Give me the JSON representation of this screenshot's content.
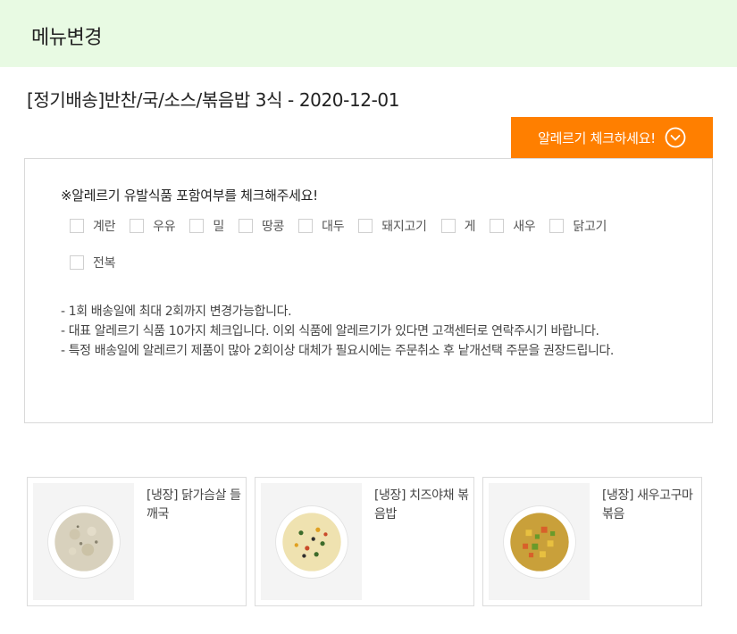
{
  "header": {
    "title": "메뉴변경"
  },
  "product": {
    "title": "[정기배송]반찬/국/소스/볶음밥 3식 - 2020-12-01"
  },
  "allergy_button": {
    "label": "알레르기 체크하세요!",
    "icon": "chevron-down-circle-icon",
    "color": "#ff7f00"
  },
  "allergy": {
    "title": "※알레르기 유발식품 포함여부를 체크해주세요!",
    "items": [
      {
        "label": "계란",
        "checked": false
      },
      {
        "label": "우유",
        "checked": false
      },
      {
        "label": "밀",
        "checked": false
      },
      {
        "label": "땅콩",
        "checked": false
      },
      {
        "label": "대두",
        "checked": false
      },
      {
        "label": "돼지고기",
        "checked": false
      },
      {
        "label": "게",
        "checked": false
      },
      {
        "label": "새우",
        "checked": false
      },
      {
        "label": "닭고기",
        "checked": false
      },
      {
        "label": "전복",
        "checked": false
      }
    ],
    "notes": [
      "- 1회 배송일에 최대 2회까지 변경가능합니다.",
      "- 대표 알레르기 식품 10가지 체크입니다. 이외 식품에 알레르기가 있다면 고객센터로 연락주시기 바랍니다.",
      "- 특정 배송일에 알레르기 제품이 많아 2회이상 대체가 필요시에는 주문취소 후 낱개선택 주문을 권장드립니다."
    ]
  },
  "products": [
    {
      "name": "[냉장] 닭가슴살 들깨국"
    },
    {
      "name": "[냉장] 치즈야채 볶음밥"
    },
    {
      "name": "[냉장] 새우고구마볶음"
    }
  ],
  "colors": {
    "header_bg": "#e8fae3",
    "accent": "#ff7f00"
  }
}
